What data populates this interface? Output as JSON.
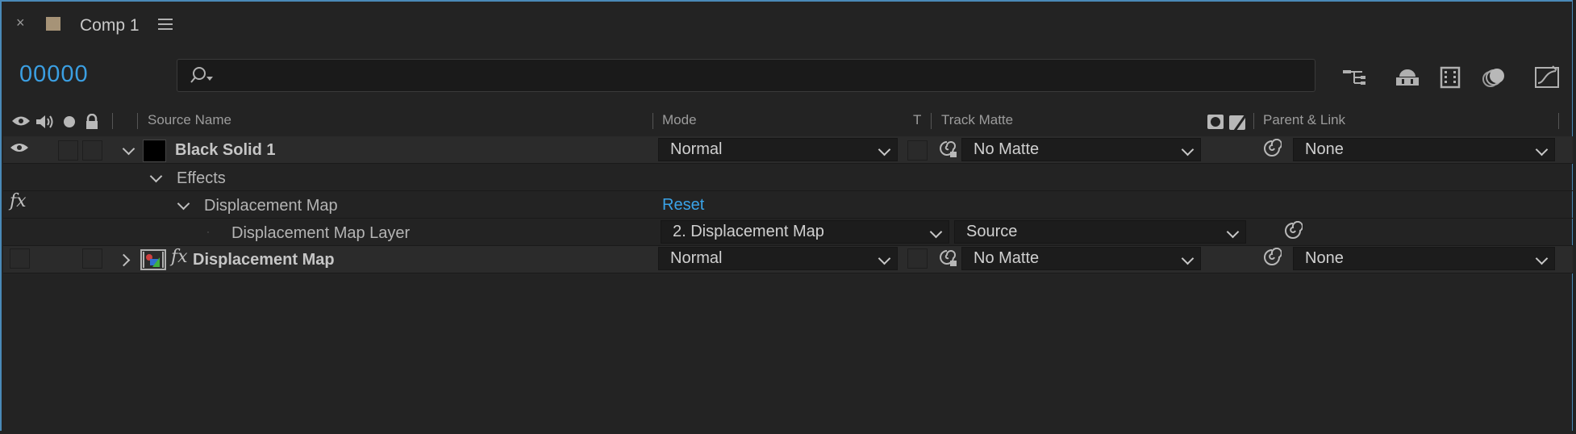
{
  "tab": {
    "close_glyph": "×",
    "title": "Comp 1",
    "swatch_color": "#a69377"
  },
  "toolbar": {
    "timecode": "00000",
    "search_value": "",
    "icons": [
      "composition-flowchart-icon",
      "draft-3d-icon",
      "frame-blending-icon",
      "motion-blur-icon",
      "graph-editor-icon"
    ]
  },
  "columns": {
    "source_name": "Source Name",
    "mode": "Mode",
    "t": "T",
    "track_matte": "Track Matte",
    "parent_link": "Parent & Link"
  },
  "layers": [
    {
      "name": "Black Solid 1",
      "mode": "Normal",
      "track_matte": "No Matte",
      "parent": "None",
      "expanded": true
    },
    {
      "name": "Displacement Map",
      "mode": "Normal",
      "track_matte": "No Matte",
      "parent": "None",
      "expanded": false
    }
  ],
  "effects": {
    "group_label": "Effects",
    "fx_label": "fx",
    "effect_name": "Displacement Map",
    "reset_label": "Reset",
    "property_name": "Displacement Map Layer",
    "layer_value": "2. Displacement Map",
    "source_value": "Source"
  },
  "colors": {
    "accent": "#3b9fe2",
    "border": "#4a8ab8",
    "background": "#232323"
  }
}
